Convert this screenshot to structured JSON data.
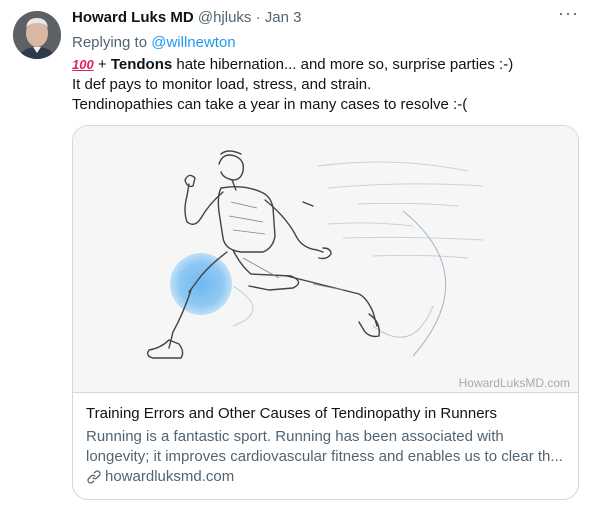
{
  "tweet": {
    "author_name": "Howard Luks MD",
    "handle": "@hjluks",
    "separator": "·",
    "time": "Jan 3",
    "reply_prefix": "Replying to",
    "reply_mention": "@willnewton",
    "emoji_100": "100",
    "text_plus": " + ",
    "text_bold": "Tendons",
    "text_line1_rest": " hate hibernation... and more so, surprise parties :-)",
    "text_line2": "It def pays to monitor load, stress, and strain.",
    "text_line3": "Tendinopathies can take a year in many cases to resolve :-("
  },
  "more_icon": "more-horizontal-icon",
  "card": {
    "image_watermark": "HowardLuksMD.com",
    "title": "Training Errors and Other Causes of Tendinopathy in Runners",
    "desc_line1": "Running is a fantastic sport. Running has been associated with",
    "desc_line2": "longevity; it improves cardiovascular fitness and enables us to clear th...",
    "domain": "howardluksmd.com",
    "domain_icon": "link-icon"
  },
  "colors": {
    "text": "#0f1419",
    "muted": "#536471",
    "link": "#1d9bf0",
    "border": "#cfd9de",
    "highlight": "#86c5f5"
  }
}
